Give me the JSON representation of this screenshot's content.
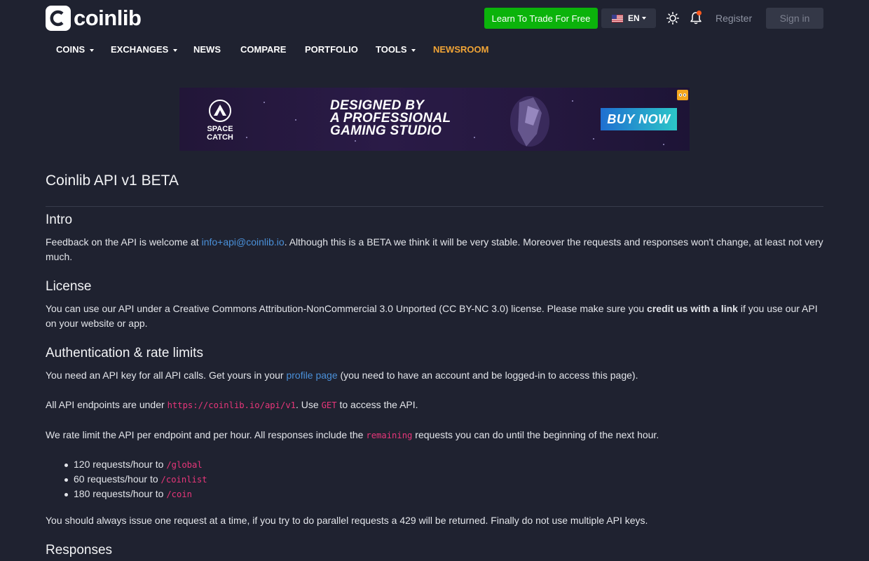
{
  "header": {
    "logo_text": "coinlib",
    "trade_button": "Learn To Trade For Free",
    "language": "EN",
    "register": "Register",
    "sign_in": "Sign in"
  },
  "nav": {
    "coins": "COINS",
    "exchanges": "EXCHANGES",
    "news": "NEWS",
    "compare": "COMPARE",
    "portfolio": "PORTFOLIO",
    "tools": "TOOLS",
    "newsroom": "NEWSROOM"
  },
  "ad": {
    "brand_line1": "SPACE",
    "brand_line2": "CATCH",
    "headline_line1": "DESIGNED BY",
    "headline_line2": "A PROFESSIONAL",
    "headline_line3": "GAMING STUDIO",
    "cta": "BUY NOW"
  },
  "page": {
    "title": "Coinlib API v1 BETA",
    "intro": {
      "heading": "Intro",
      "text_1": "Feedback on the API is welcome at ",
      "email": "info+api@coinlib.io",
      "text_2": ". Although this is a BETA we think it will be very stable. Moreover the requests and responses won't change, at least not very much."
    },
    "license": {
      "heading": "License",
      "text_1": "You can use our API under a Creative Commons Attribution-NonCommercial 3.0 Unported (CC BY-NC 3.0) license. Please make sure you ",
      "bold": "credit us with a link",
      "text_2": " if you use our API on your website or app."
    },
    "auth": {
      "heading": "Authentication & rate limits",
      "p1_text_1": "You need an API key for all API calls. Get yours in your ",
      "p1_link": "profile page",
      "p1_text_2": " (you need to have an account and be logged-in to access this page).",
      "p2_text_1": "All API endpoints are under ",
      "p2_code_1": "https://coinlib.io/api/v1",
      "p2_text_2": ". Use ",
      "p2_code_2": "GET",
      "p2_text_3": " to access the API.",
      "p3_text_1": "We rate limit the API per endpoint and per hour. All responses include the ",
      "p3_code": "remaining",
      "p3_text_2": " requests you can do until the beginning of the next hour.",
      "limits": [
        {
          "text": "120 requests/hour to ",
          "endpoint": "/global"
        },
        {
          "text": "60 requests/hour to ",
          "endpoint": "/coinlist"
        },
        {
          "text": "180 requests/hour to ",
          "endpoint": "/coin"
        }
      ],
      "p4": "You should always issue one request at a time, if you try to do parallel requests a 429 will be returned. Finally do not use multiple API keys."
    },
    "responses": {
      "heading": "Responses"
    }
  },
  "colors": {
    "background": "#1f2230",
    "accent_green": "#0bb30b",
    "link": "#4a90d9",
    "code": "#e8367a",
    "newsroom": "#f0a436"
  }
}
